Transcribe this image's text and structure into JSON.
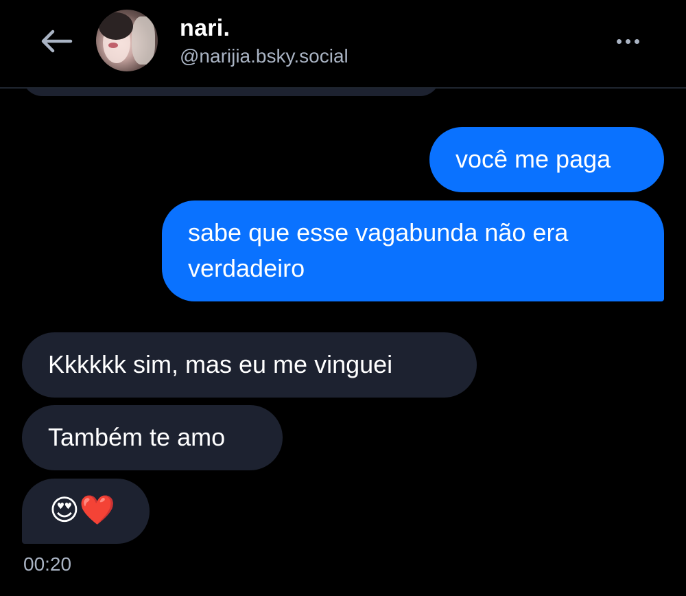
{
  "header": {
    "name": "nari.",
    "handle": "@narijia.bsky.social",
    "back_icon": "arrow-left-icon",
    "more_icon": "ellipsis-horizontal-icon"
  },
  "messages": [
    {
      "direction": "outgoing",
      "text": "você me paga"
    },
    {
      "direction": "outgoing",
      "text": "sabe que esse vagabunda não era verdadeiro"
    },
    {
      "direction": "incoming",
      "text": "Kkkkkk sim, mas eu me vinguei"
    },
    {
      "direction": "incoming",
      "text": "Também te amo"
    },
    {
      "direction": "incoming",
      "text": "😍❤️"
    }
  ],
  "timestamp": "00:20",
  "colors": {
    "background": "#000000",
    "outgoing_bubble": "#0a72ff",
    "incoming_bubble": "#1d2230",
    "secondary_text": "#aab4c4"
  }
}
